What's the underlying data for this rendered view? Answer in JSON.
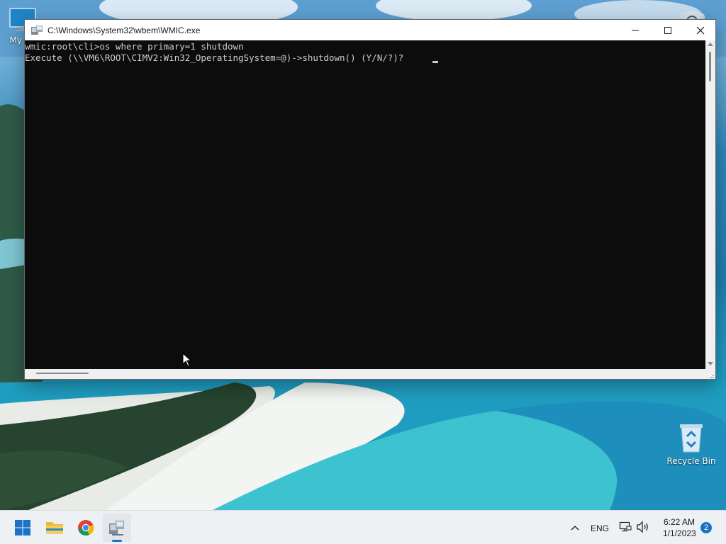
{
  "window": {
    "title": "C:\\Windows\\System32\\wbem\\WMIC.exe",
    "minimize_icon": "minimize-icon",
    "maximize_icon": "maximize-icon",
    "close_icon": "close-icon"
  },
  "console": {
    "lines": [
      "wmic:root\\cli>os where primary=1 shutdown",
      "Execute (\\\\VM6\\ROOT\\CIMV2:Win32_OperatingSystem=@)->shutdown() (Y/N/?)? "
    ],
    "background_color": "#0c0c0c",
    "text_color": "#cccccc"
  },
  "desktop": {
    "icons": [
      {
        "label": "My Co",
        "icon": "computer-icon"
      },
      {
        "label": "Recycle Bin",
        "icon": "recycle-bin-icon"
      }
    ],
    "top_right_icon": "camera-icon"
  },
  "taskbar": {
    "buttons": [
      {
        "name": "Start",
        "icon": "windows-logo-icon"
      },
      {
        "name": "File Explorer",
        "icon": "folder-icon"
      },
      {
        "name": "Google Chrome",
        "icon": "chrome-icon"
      },
      {
        "name": "WMIC",
        "icon": "wmic-icon",
        "active": true
      }
    ],
    "tray": {
      "chevron_icon": "chevron-up-icon",
      "language": "ENG",
      "network_icon": "network-icon",
      "volume_icon": "volume-icon",
      "time": "6:22 AM",
      "date": "1/1/2023",
      "notification_count": "2"
    },
    "accent_color": "#1a73c7"
  }
}
